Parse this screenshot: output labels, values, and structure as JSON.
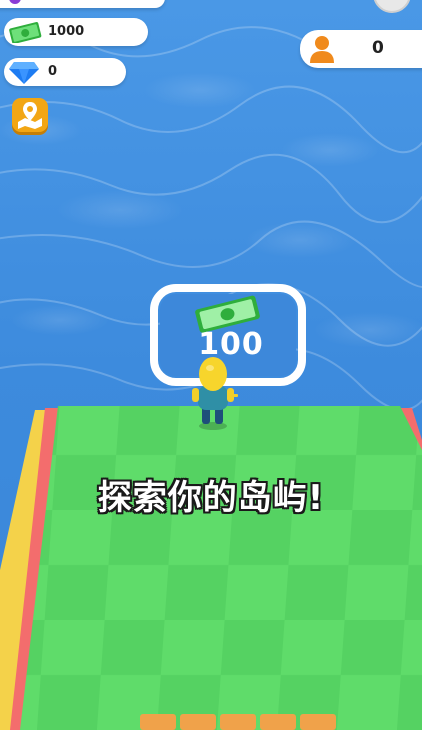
{
  "hud": {
    "cash_value": "1000",
    "gem_value": "0",
    "player_count": "0"
  },
  "world": {
    "pad_cost": "100"
  },
  "caption": "探索你的岛屿!",
  "colors": {
    "water": "#3f8fe0",
    "grass_light": "#5fdc6a",
    "grass_dark": "#50cc5c",
    "cash_green": "#3ec64a",
    "gem_blue": "#1e7cf2",
    "player_orange": "#f08a1c",
    "map_orange": "#f2a614"
  },
  "icons": [
    "cash-icon",
    "gem-icon",
    "player-icon",
    "map-location-icon",
    "gear-icon",
    "cash-bill-icon"
  ]
}
